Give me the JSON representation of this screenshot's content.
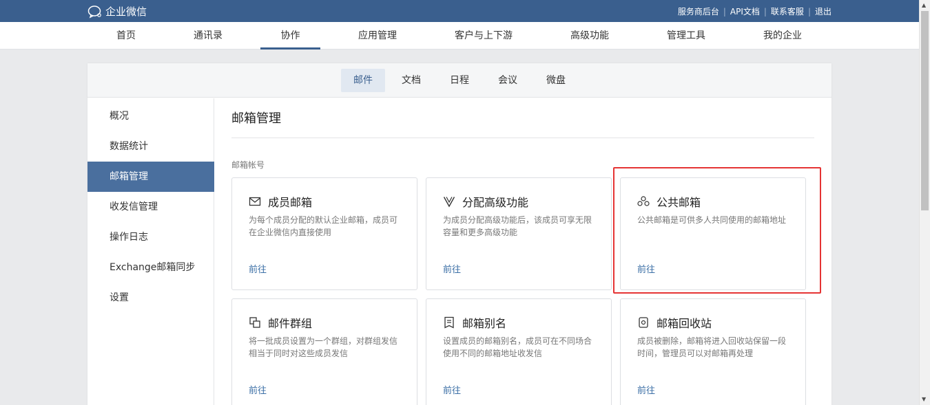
{
  "app": {
    "logo_text": "企业微信"
  },
  "toplinks": [
    "服务商后台",
    "API文档",
    "联系客服",
    "退出"
  ],
  "mainnav": [
    "首页",
    "通讯录",
    "协作",
    "应用管理",
    "客户与上下游",
    "高级功能",
    "管理工具",
    "我的企业"
  ],
  "mainnav_active": "协作",
  "subnav": [
    "邮件",
    "文档",
    "日程",
    "会议",
    "微盘"
  ],
  "subnav_active": "邮件",
  "sidebar": [
    "概况",
    "数据统计",
    "邮箱管理",
    "收发信管理",
    "操作日志",
    "Exchange邮箱同步",
    "设置"
  ],
  "sidebar_active": "邮箱管理",
  "page_title": "邮箱管理",
  "section_label": "邮箱帐号",
  "cards": [
    {
      "icon": "envelope-icon",
      "title": "成员邮箱",
      "desc": "为每个成员分配的默认企业邮箱，成员可在企业微信内直接使用",
      "link": "前往"
    },
    {
      "icon": "v-badge-icon",
      "title": "分配高级功能",
      "desc": "为成员分配高级功能后，该成员可享无限容量和更多高级功能",
      "link": "前往"
    },
    {
      "icon": "people-circle-icon",
      "title": "公共邮箱",
      "desc": "公共邮箱是可供多人共同使用的邮箱地址",
      "link": "前往"
    },
    {
      "icon": "group-squares-icon",
      "title": "邮件群组",
      "desc": "将一批成员设置为一个群组，对群组发信相当于同时对这些成员发信",
      "link": "前往"
    },
    {
      "icon": "document-list-icon",
      "title": "邮箱别名",
      "desc": "设置成员的邮箱别名，成员可在不同场合使用不同的邮箱地址收发信",
      "link": "前往"
    },
    {
      "icon": "recycle-bin-icon",
      "title": "邮箱回收站",
      "desc": "成员被删除，邮箱将进入回收站保留一段时间，管理员可以对邮箱再处理",
      "link": "前往"
    }
  ],
  "colors": {
    "topbar": "#3a5f8e",
    "sidebar_active": "#4a6f9e",
    "link": "#3a6ea5",
    "highlight": "#e53333"
  }
}
